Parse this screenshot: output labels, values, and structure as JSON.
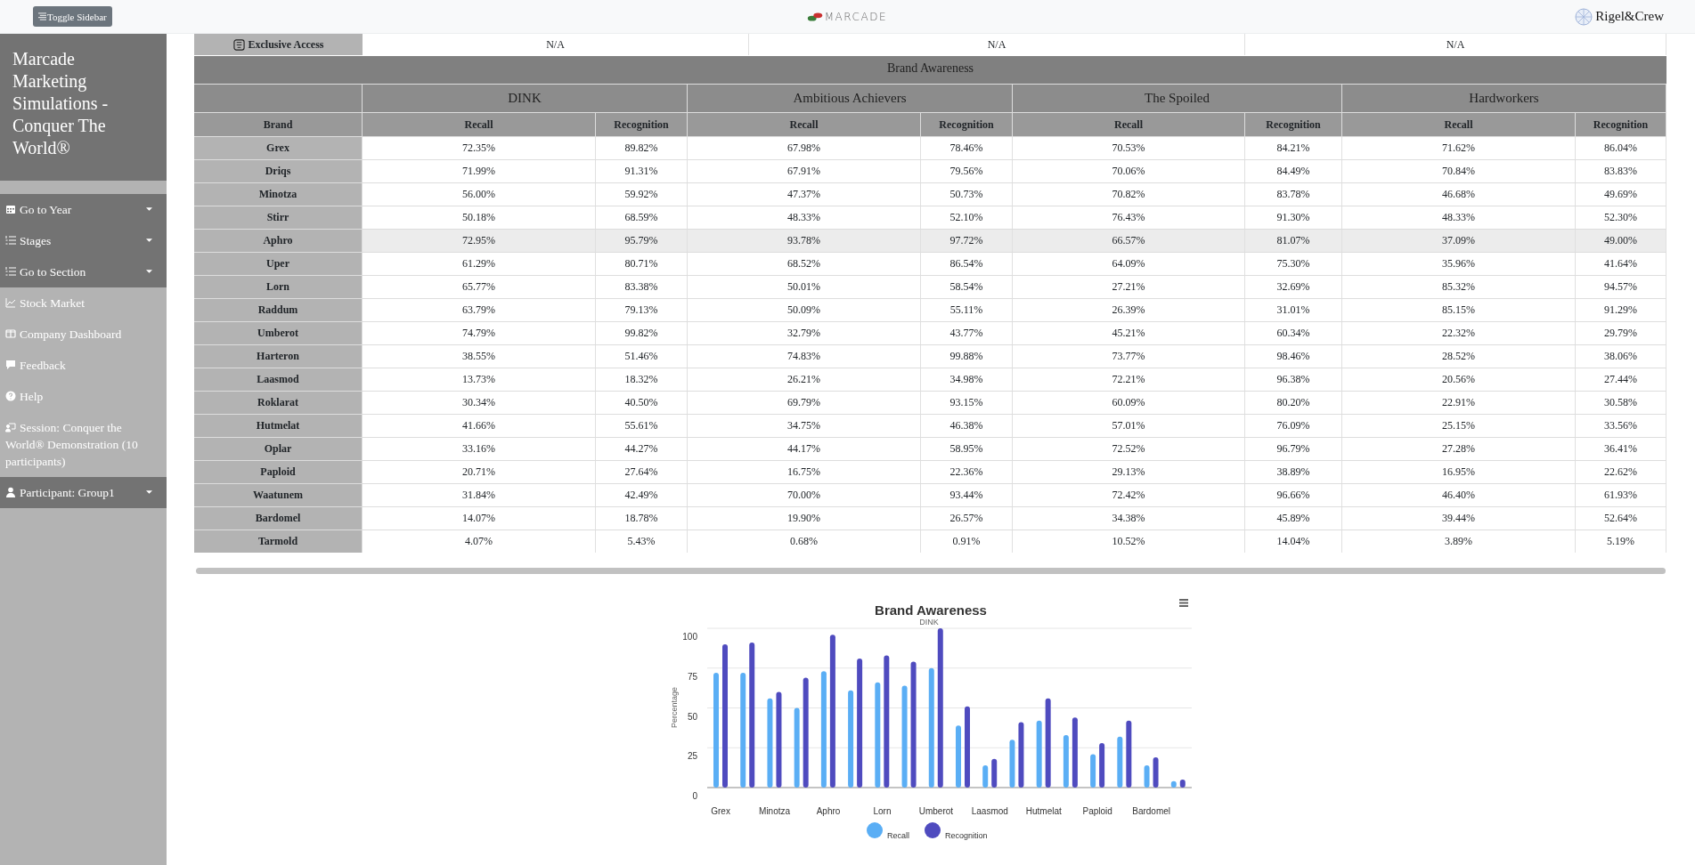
{
  "topbar": {
    "toggle_button": "Toggle Sidebar",
    "logo": "MARCADE",
    "brand": "Rigel&Crew"
  },
  "sidebar": {
    "title": "Marcade Marketing Simulations - Conquer The World®",
    "items": [
      {
        "label": "Go to Year",
        "kind": "dropdown"
      },
      {
        "label": "Stages",
        "kind": "dropdown"
      },
      {
        "label": "Go to Section",
        "kind": "dropdown"
      },
      {
        "label": "Stock Market",
        "kind": "link"
      },
      {
        "label": "Company Dashboard",
        "kind": "link"
      },
      {
        "label": "Feedback",
        "kind": "link"
      },
      {
        "label": "Help",
        "kind": "link"
      },
      {
        "label": "Session: Conquer the World® Demonstration (10 participants)",
        "kind": "link"
      },
      {
        "label": "Participant: Group1",
        "kind": "dropdown"
      }
    ]
  },
  "exclusive_row": {
    "label": "Exclusive Access",
    "values": [
      "N/A",
      "N/A",
      "N/A"
    ]
  },
  "table": {
    "title": "Brand Awareness",
    "segments": [
      "DINK",
      "Ambitious Achievers",
      "The Spoiled",
      "Hardworkers"
    ],
    "columns": [
      "Brand",
      "Recall",
      "Recognition",
      "Recall",
      "Recognition",
      "Recall",
      "Recognition",
      "Recall",
      "Recognition"
    ],
    "rows": [
      {
        "highlighted": false,
        "cells": [
          "Grex",
          "72.35%",
          "89.82%",
          "67.98%",
          "78.46%",
          "70.53%",
          "84.21%",
          "71.62%",
          "86.04%"
        ]
      },
      {
        "highlighted": false,
        "cells": [
          "Driqs",
          "71.99%",
          "91.31%",
          "67.91%",
          "79.56%",
          "70.06%",
          "84.49%",
          "70.84%",
          "83.83%"
        ]
      },
      {
        "highlighted": false,
        "cells": [
          "Minotza",
          "56.00%",
          "59.92%",
          "47.37%",
          "50.73%",
          "70.82%",
          "83.78%",
          "46.68%",
          "49.69%"
        ]
      },
      {
        "highlighted": false,
        "cells": [
          "Stirr",
          "50.18%",
          "68.59%",
          "48.33%",
          "52.10%",
          "76.43%",
          "91.30%",
          "48.33%",
          "52.30%"
        ]
      },
      {
        "highlighted": true,
        "cells": [
          "Aphro",
          "72.95%",
          "95.79%",
          "93.78%",
          "97.72%",
          "66.57%",
          "81.07%",
          "37.09%",
          "49.00%"
        ]
      },
      {
        "highlighted": false,
        "cells": [
          "Uper",
          "61.29%",
          "80.71%",
          "68.52%",
          "86.54%",
          "64.09%",
          "75.30%",
          "35.96%",
          "41.64%"
        ]
      },
      {
        "highlighted": false,
        "cells": [
          "Lorn",
          "65.77%",
          "83.38%",
          "50.01%",
          "58.54%",
          "27.21%",
          "32.69%",
          "85.32%",
          "94.57%"
        ]
      },
      {
        "highlighted": false,
        "cells": [
          "Raddum",
          "63.79%",
          "79.13%",
          "50.09%",
          "55.11%",
          "26.39%",
          "31.01%",
          "85.15%",
          "91.29%"
        ]
      },
      {
        "highlighted": false,
        "cells": [
          "Umberot",
          "74.79%",
          "99.82%",
          "32.79%",
          "43.77%",
          "45.21%",
          "60.34%",
          "22.32%",
          "29.79%"
        ]
      },
      {
        "highlighted": false,
        "cells": [
          "Harteron",
          "38.55%",
          "51.46%",
          "74.83%",
          "99.88%",
          "73.77%",
          "98.46%",
          "28.52%",
          "38.06%"
        ]
      },
      {
        "highlighted": false,
        "cells": [
          "Laasmod",
          "13.73%",
          "18.32%",
          "26.21%",
          "34.98%",
          "72.21%",
          "96.38%",
          "20.56%",
          "27.44%"
        ]
      },
      {
        "highlighted": false,
        "cells": [
          "Roklarat",
          "30.34%",
          "40.50%",
          "69.79%",
          "93.15%",
          "60.09%",
          "80.20%",
          "22.91%",
          "30.58%"
        ]
      },
      {
        "highlighted": false,
        "cells": [
          "Hutmelat",
          "41.66%",
          "55.61%",
          "34.75%",
          "46.38%",
          "57.01%",
          "76.09%",
          "25.15%",
          "33.56%"
        ]
      },
      {
        "highlighted": false,
        "cells": [
          "Oplar",
          "33.16%",
          "44.27%",
          "44.17%",
          "58.95%",
          "72.52%",
          "96.79%",
          "27.28%",
          "36.41%"
        ]
      },
      {
        "highlighted": false,
        "cells": [
          "Paploid",
          "20.71%",
          "27.64%",
          "16.75%",
          "22.36%",
          "29.13%",
          "38.89%",
          "16.95%",
          "22.62%"
        ]
      },
      {
        "highlighted": false,
        "cells": [
          "Waatunem",
          "31.84%",
          "42.49%",
          "70.00%",
          "93.44%",
          "72.42%",
          "96.66%",
          "46.40%",
          "61.93%"
        ]
      },
      {
        "highlighted": false,
        "cells": [
          "Bardomel",
          "14.07%",
          "18.78%",
          "19.90%",
          "26.57%",
          "34.38%",
          "45.89%",
          "39.44%",
          "52.64%"
        ]
      },
      {
        "highlighted": false,
        "cells": [
          "Tarmold",
          "4.07%",
          "5.43%",
          "0.68%",
          "0.91%",
          "10.52%",
          "14.04%",
          "3.89%",
          "5.19%"
        ]
      }
    ]
  },
  "chart": {
    "chart_data": {
      "type": "bar",
      "title": "Brand Awareness",
      "subtitle": "DINK",
      "ylabel": "Percentage",
      "categories": [
        "Grex",
        null,
        "Minotza",
        null,
        "Aphro",
        null,
        "Lorn",
        null,
        "Umberot",
        null,
        "Laasmod",
        null,
        "Hutmelat",
        null,
        "Paploid",
        null,
        "Bardomel",
        null
      ],
      "ylim": [
        0,
        100
      ],
      "yticks": [
        0,
        25,
        50,
        75,
        100
      ],
      "grid": true,
      "legend": "bottom",
      "series": [
        {
          "name": "Recall",
          "color": "#5aaef5",
          "values": [
            72,
            72,
            56,
            50,
            73,
            61,
            66,
            64,
            75,
            39,
            14,
            30,
            42,
            33,
            21,
            32,
            14,
            4
          ]
        },
        {
          "name": "Recognition",
          "color": "#4f4bbf",
          "values": [
            90,
            91,
            60,
            69,
            96,
            81,
            83,
            79,
            100,
            51,
            18,
            41,
            56,
            44,
            28,
            42,
            19,
            5
          ]
        }
      ]
    }
  }
}
